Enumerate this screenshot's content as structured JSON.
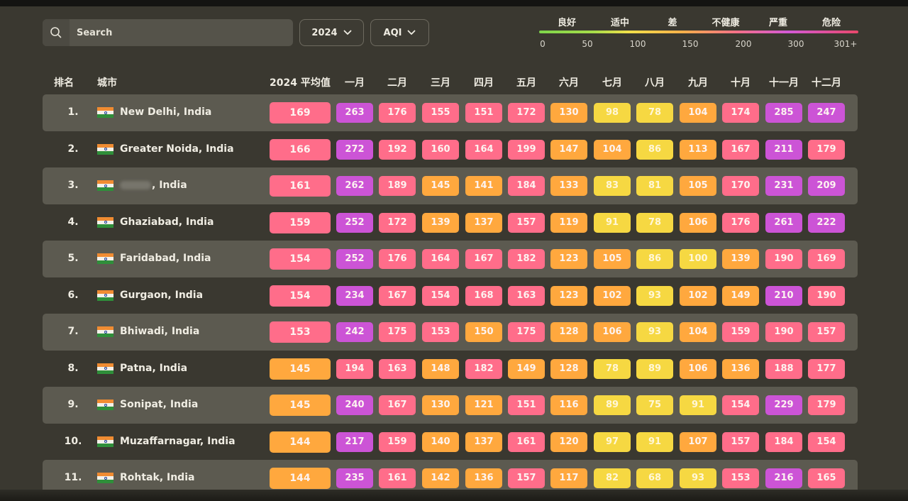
{
  "search": {
    "placeholder": "Search",
    "icon": "search-icon"
  },
  "filters": {
    "year": "2024",
    "metric": "AQI"
  },
  "scale": {
    "categories": [
      "良好",
      "适中",
      "差",
      "不健康",
      "严重",
      "危险"
    ],
    "ticks": [
      "0",
      "50",
      "100",
      "150",
      "200",
      "300",
      "301+"
    ]
  },
  "headers": {
    "rank": "排名",
    "city": "城市",
    "avg": "2024 平均值",
    "months": [
      "一月",
      "二月",
      "三月",
      "四月",
      "五月",
      "六月",
      "七月",
      "八月",
      "九月",
      "十月",
      "十一月",
      "十二月"
    ]
  },
  "rows": [
    {
      "rank": "1.",
      "city": "New Delhi, India",
      "avg": "169",
      "months": [
        "263",
        "176",
        "155",
        "151",
        "172",
        "130",
        "98",
        "78",
        "104",
        "174",
        "285",
        "247"
      ]
    },
    {
      "rank": "2.",
      "city": "Greater Noida, India",
      "avg": "166",
      "months": [
        "272",
        "192",
        "160",
        "164",
        "199",
        "147",
        "104",
        "86",
        "113",
        "167",
        "211",
        "179"
      ]
    },
    {
      "rank": "3.",
      "city": ", India",
      "avg": "161",
      "months": [
        "262",
        "189",
        "145",
        "141",
        "184",
        "133",
        "83",
        "81",
        "105",
        "170",
        "231",
        "209"
      ]
    },
    {
      "rank": "4.",
      "city": "Ghaziabad, India",
      "avg": "159",
      "months": [
        "252",
        "172",
        "139",
        "137",
        "157",
        "119",
        "91",
        "78",
        "106",
        "176",
        "261",
        "222"
      ]
    },
    {
      "rank": "5.",
      "city": "Faridabad, India",
      "avg": "154",
      "months": [
        "252",
        "176",
        "164",
        "167",
        "182",
        "123",
        "105",
        "86",
        "100",
        "139",
        "190",
        "169"
      ]
    },
    {
      "rank": "6.",
      "city": "Gurgaon, India",
      "avg": "154",
      "months": [
        "234",
        "167",
        "154",
        "168",
        "163",
        "123",
        "102",
        "93",
        "102",
        "149",
        "210",
        "190"
      ]
    },
    {
      "rank": "7.",
      "city": "Bhiwadi, India",
      "avg": "153",
      "months": [
        "242",
        "175",
        "153",
        "150",
        "175",
        "128",
        "106",
        "93",
        "104",
        "159",
        "190",
        "157"
      ]
    },
    {
      "rank": "8.",
      "city": "Patna, India",
      "avg": "145",
      "months": [
        "194",
        "163",
        "148",
        "182",
        "149",
        "128",
        "78",
        "89",
        "106",
        "136",
        "188",
        "177"
      ]
    },
    {
      "rank": "9.",
      "city": "Sonipat, India",
      "avg": "145",
      "months": [
        "240",
        "167",
        "130",
        "121",
        "151",
        "116",
        "89",
        "75",
        "91",
        "154",
        "229",
        "179"
      ]
    },
    {
      "rank": "10.",
      "city": "Muzaffarnagar, India",
      "avg": "144",
      "months": [
        "217",
        "159",
        "140",
        "137",
        "161",
        "120",
        "97",
        "91",
        "107",
        "157",
        "184",
        "154"
      ]
    },
    {
      "rank": "11.",
      "city": "Rohtak, India",
      "avg": "144",
      "months": [
        "235",
        "161",
        "142",
        "136",
        "157",
        "117",
        "82",
        "68",
        "93",
        "153",
        "216",
        "165"
      ]
    }
  ]
}
